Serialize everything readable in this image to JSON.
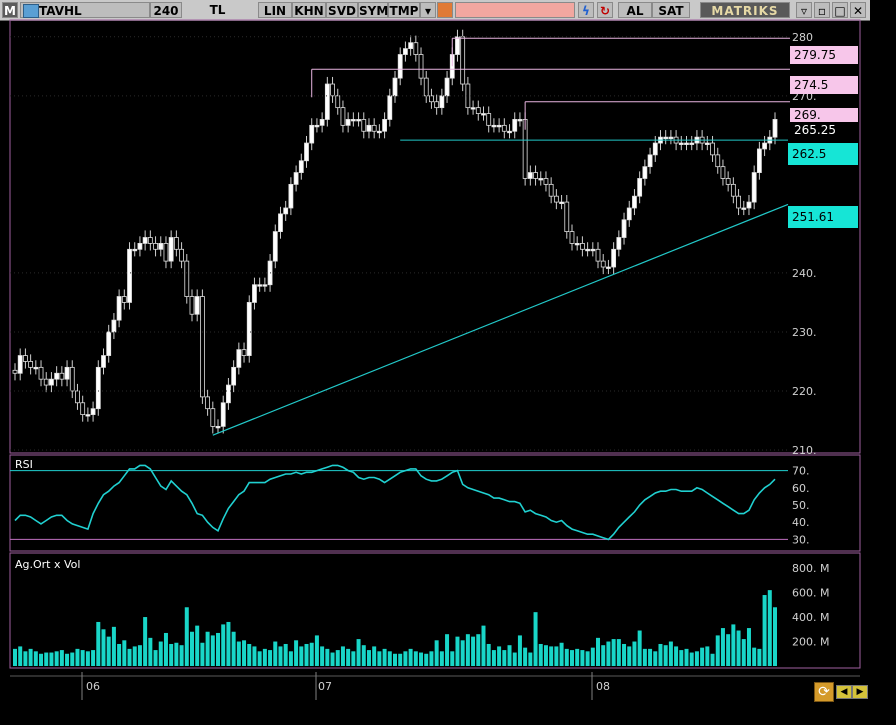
{
  "toolbar": {
    "m_label": "M",
    "symbol": "TAVHL",
    "period": "240",
    "currency": "TL",
    "buttons": [
      "LIN",
      "KHN",
      "SVD",
      "SYM",
      "TMP"
    ],
    "buy": "AL",
    "sell": "SAT",
    "brand": "MATRIKS",
    "icons": [
      "dropdown-arrow-icon",
      "twitter-icon",
      "lightning-icon",
      "refresh-circle-icon",
      "minimize-icon",
      "restore-icon",
      "close-icon"
    ]
  },
  "colors": {
    "up_candle": "#ffffff",
    "down_candle": "#000000",
    "trendline": "#22c8c8",
    "resistance": "#e8b4e0",
    "rsi_line": "#20d0d0",
    "volume_bar": "#19d6c8",
    "panel_border": "#a060a0",
    "grid": "#5a5a5a"
  },
  "price_levels": [
    {
      "label": "279.75",
      "style": "pink"
    },
    {
      "label": "274.5",
      "style": "pink"
    },
    {
      "label": "269.",
      "style": "pink"
    },
    {
      "label": "265.25",
      "style": "plain"
    },
    {
      "label": "262.5",
      "style": "cyan"
    },
    {
      "label": "251.61",
      "style": "cyan"
    }
  ],
  "panels": {
    "rsi_label": "RSI",
    "volume_label": "Ag.Ort x Vol"
  },
  "x_labels": [
    "06",
    "07",
    "08"
  ],
  "chart_data": [
    {
      "type": "candlestick",
      "ylim": [
        210,
        282
      ],
      "ticks": [
        "210.",
        "220.",
        "230.",
        "240.",
        "270.",
        "280"
      ],
      "close": [
        223,
        226,
        225,
        224,
        224,
        222,
        221,
        222,
        223,
        222,
        224,
        220,
        218,
        216,
        216,
        217,
        224,
        226,
        230,
        232,
        236,
        235,
        244,
        244,
        245,
        246,
        245,
        244,
        245,
        242,
        246,
        244,
        242,
        236,
        233,
        236,
        219,
        217,
        214,
        214,
        218,
        221,
        224,
        227,
        226,
        235,
        238,
        238,
        238,
        242,
        247,
        250,
        251,
        255,
        257,
        259,
        262,
        265,
        265,
        266,
        272,
        270,
        268,
        265,
        266,
        266,
        266,
        264,
        265,
        264,
        264,
        266,
        270,
        273,
        277,
        278,
        279,
        277,
        273,
        270,
        269,
        268,
        270,
        273,
        277,
        280,
        272,
        268,
        268,
        267,
        267,
        265,
        265,
        265,
        264,
        264,
        266,
        266,
        256,
        257,
        256,
        256,
        255,
        253,
        252,
        252,
        247,
        245,
        245,
        244,
        244,
        244,
        242,
        241,
        241,
        244,
        246,
        249,
        251,
        253,
        256,
        258,
        260,
        262,
        263,
        263,
        263,
        262,
        262,
        262,
        262,
        263,
        262,
        262,
        260,
        258,
        256,
        255,
        253,
        251,
        251,
        252,
        257,
        261,
        262,
        263,
        266
      ],
      "y_annotations": {
        "resistance_levels": [
          279.75,
          274.5,
          269
        ],
        "support_level": 262.5,
        "trendline_value": 251.61,
        "last": 265.25
      }
    },
    {
      "type": "line",
      "name": "RSI",
      "ylim": [
        25,
        75
      ],
      "ticks": [
        "30.",
        "40.",
        "50.",
        "60.",
        "70."
      ],
      "bands": [
        70,
        30
      ],
      "values": [
        41,
        44,
        44,
        43,
        41,
        39,
        41,
        43,
        44,
        44,
        41,
        39,
        38,
        37,
        36,
        45,
        51,
        56,
        58,
        61,
        63,
        67,
        71,
        71,
        73,
        73,
        71,
        66,
        61,
        59,
        64,
        61,
        58,
        56,
        51,
        45,
        44,
        40,
        37,
        35,
        42,
        48,
        52,
        56,
        58,
        63,
        63,
        63,
        63,
        65,
        66,
        67,
        68,
        68,
        69,
        68,
        69,
        69,
        70,
        71,
        72,
        73,
        73,
        72,
        70,
        69,
        66,
        65,
        66,
        66,
        65,
        63,
        65,
        67,
        69,
        70,
        71,
        71,
        67,
        65,
        64,
        64,
        65,
        67,
        69,
        70,
        62,
        60,
        59,
        58,
        57,
        56,
        54,
        54,
        53,
        52,
        52,
        51,
        46,
        47,
        45,
        44,
        43,
        41,
        40,
        41,
        38,
        36,
        35,
        34,
        33,
        33,
        32,
        31,
        30,
        33,
        37,
        40,
        43,
        46,
        50,
        53,
        55,
        57,
        58,
        58,
        59,
        59,
        58,
        58,
        58,
        60,
        59,
        57,
        55,
        53,
        51,
        49,
        47,
        45,
        45,
        47,
        53,
        57,
        60,
        62,
        65
      ]
    },
    {
      "type": "bar",
      "name": "Ag.Ort x Vol",
      "ylim": [
        0,
        850
      ],
      "ticks": [
        "200. M",
        "400. M",
        "600. M",
        "800. M"
      ],
      "values": [
        140,
        160,
        120,
        140,
        120,
        100,
        110,
        110,
        120,
        130,
        100,
        110,
        140,
        130,
        120,
        130,
        360,
        300,
        240,
        320,
        180,
        210,
        140,
        160,
        170,
        400,
        230,
        130,
        200,
        270,
        180,
        190,
        170,
        480,
        280,
        330,
        190,
        280,
        250,
        270,
        340,
        360,
        280,
        200,
        210,
        180,
        160,
        120,
        140,
        130,
        200,
        160,
        180,
        120,
        210,
        160,
        180,
        190,
        250,
        160,
        140,
        110,
        130,
        160,
        140,
        120,
        220,
        170,
        130,
        160,
        120,
        140,
        120,
        100,
        100,
        120,
        140,
        120,
        110,
        100,
        120,
        210,
        120,
        260,
        120,
        240,
        210,
        260,
        240,
        260,
        330,
        180,
        130,
        160,
        130,
        170,
        110,
        250,
        150,
        110,
        440,
        180,
        170,
        160,
        160,
        190,
        140,
        130,
        140,
        130,
        120,
        150,
        230,
        170,
        200,
        220,
        220,
        180,
        160,
        200,
        290,
        140,
        140,
        120,
        180,
        170,
        200,
        160,
        130,
        140,
        110,
        120,
        150,
        160,
        100,
        250,
        310,
        260,
        340,
        290,
        220,
        310,
        150,
        140,
        580,
        620,
        480
      ]
    }
  ]
}
